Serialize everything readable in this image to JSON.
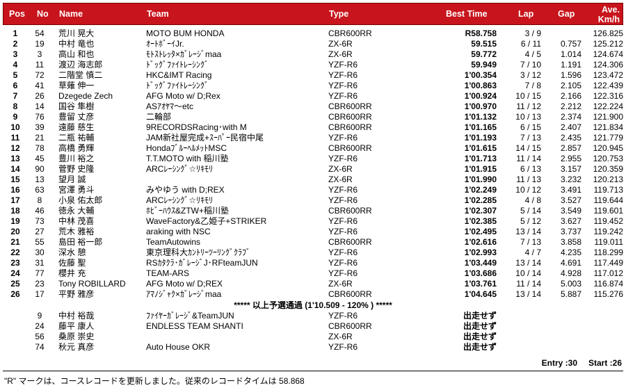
{
  "headers": {
    "pos": "Pos",
    "no": "No",
    "name": "Name",
    "team": "Team",
    "type": "Type",
    "best": "Best Time",
    "lap": "Lap",
    "gap": "Gap",
    "ave1": "Ave.",
    "ave2": "Km/h"
  },
  "rows": [
    {
      "pos": "1",
      "no": "54",
      "name": "荒川 晃大",
      "team": "MOTO BUM HONDA",
      "type": "CBR600RR",
      "best": "R58.758",
      "lap": "3 / 9",
      "gap": "",
      "ave": "126.825"
    },
    {
      "pos": "2",
      "no": "19",
      "name": "中村 竜也",
      "team": "ｵｰﾄﾎﾞｰｲJr.",
      "type": "ZX-6R",
      "best": "59.515",
      "lap": "6 / 11",
      "gap": "0.757",
      "ave": "125.212"
    },
    {
      "pos": "3",
      "no": "3",
      "name": "高山 和也",
      "team": "ﾓﾄｽﾄﾚｯﾀ×ｶﾞﾚｰｼﾞmaa",
      "type": "ZX-6R",
      "best": "59.772",
      "lap": "4 / 5",
      "gap": "1.014",
      "ave": "124.674"
    },
    {
      "pos": "4",
      "no": "11",
      "name": "渡辺 海志郎",
      "team": "ﾄﾞｯｸﾞﾌｧｲﾄﾚｰｼﾝｸﾞ",
      "type": "YZF-R6",
      "best": "59.949",
      "lap": "7 / 10",
      "gap": "1.191",
      "ave": "124.306"
    },
    {
      "pos": "5",
      "no": "72",
      "name": "二階堂 慎二",
      "team": "HKC&IMT Racing",
      "type": "YZF-R6",
      "best": "1'00.354",
      "lap": "3 / 12",
      "gap": "1.596",
      "ave": "123.472"
    },
    {
      "pos": "6",
      "no": "41",
      "name": "草薙 伸一",
      "team": "ﾄﾞｯｸﾞﾌｧｲﾄﾚｰｼﾝｸﾞ",
      "type": "YZF-R6",
      "best": "1'00.863",
      "lap": "7 / 8",
      "gap": "2.105",
      "ave": "122.439"
    },
    {
      "pos": "7",
      "no": "26",
      "name": "Dzegede Zech",
      "team": "AFG Moto w/ D;Rex",
      "type": "YZF-R6",
      "best": "1'00.924",
      "lap": "10 / 15",
      "gap": "2.166",
      "ave": "122.316"
    },
    {
      "pos": "8",
      "no": "14",
      "name": "国谷 隼樹",
      "team": "ASｱｵﾔﾏ～etc",
      "type": "CBR600RR",
      "best": "1'00.970",
      "lap": "11 / 12",
      "gap": "2.212",
      "ave": "122.224"
    },
    {
      "pos": "9",
      "no": "76",
      "name": "豊留 丈彦",
      "team": "二輪部",
      "type": "CBR600RR",
      "best": "1'01.132",
      "lap": "10 / 13",
      "gap": "2.374",
      "ave": "121.900"
    },
    {
      "pos": "10",
      "no": "39",
      "name": "遠藤 慈生",
      "team": "9RECORDSRacing･with M",
      "type": "CBR600RR",
      "best": "1'01.165",
      "lap": "6 / 15",
      "gap": "2.407",
      "ave": "121.834"
    },
    {
      "pos": "11",
      "no": "21",
      "name": "二瓶 祐輔",
      "team": "JAM新社屋完成+ｽｰﾊﾟｰ民宿中尾",
      "type": "YZF-R6",
      "best": "1'01.193",
      "lap": "7 / 13",
      "gap": "2.435",
      "ave": "121.779"
    },
    {
      "pos": "12",
      "no": "78",
      "name": "高橋 勇輝",
      "team": "HondaﾌﾞﾙｰﾍﾙﾒｯﾄMSC",
      "type": "CBR600RR",
      "best": "1'01.615",
      "lap": "14 / 15",
      "gap": "2.857",
      "ave": "120.945"
    },
    {
      "pos": "13",
      "no": "45",
      "name": "豊川 裕之",
      "team": "T.T.MOTO with 稲川塾",
      "type": "YZF-R6",
      "best": "1'01.713",
      "lap": "11 / 14",
      "gap": "2.955",
      "ave": "120.753"
    },
    {
      "pos": "14",
      "no": "90",
      "name": "菅野 史隆",
      "team": "ARCﾚｰｼﾝｸﾞ☆ﾘｷﾓﾘ",
      "type": "ZX-6R",
      "best": "1'01.915",
      "lap": "6 / 13",
      "gap": "3.157",
      "ave": "120.359"
    },
    {
      "pos": "15",
      "no": "13",
      "name": "望月 誠",
      "team": "",
      "type": "ZX-6R",
      "best": "1'01.990",
      "lap": "11 / 13",
      "gap": "3.232",
      "ave": "120.213"
    },
    {
      "pos": "16",
      "no": "63",
      "name": "宮澤 勇斗",
      "team": "みやゆう with D;REX",
      "type": "YZF-R6",
      "best": "1'02.249",
      "lap": "10 / 12",
      "gap": "3.491",
      "ave": "119.713"
    },
    {
      "pos": "17",
      "no": "8",
      "name": "小泉 佑太郎",
      "team": "ARCﾚｰｼﾝｸﾞ☆ﾘｷﾓﾘ",
      "type": "YZF-R6",
      "best": "1'02.285",
      "lap": "4 / 8",
      "gap": "3.527",
      "ave": "119.644"
    },
    {
      "pos": "18",
      "no": "46",
      "name": "徳永 大輔",
      "team": "ﾎﾋﾞｰﾊｳｽ&ZTW+稲川塾",
      "type": "CBR600RR",
      "best": "1'02.307",
      "lap": "5 / 14",
      "gap": "3.549",
      "ave": "119.601"
    },
    {
      "pos": "19",
      "no": "73",
      "name": "中林 茂喜",
      "team": "WaveFactory&乙姫子+STRIKER",
      "type": "YZF-R6",
      "best": "1'02.385",
      "lap": "5 / 12",
      "gap": "3.627",
      "ave": "119.452"
    },
    {
      "pos": "20",
      "no": "27",
      "name": "荒木 雅裕",
      "team": "araking with NSC",
      "type": "YZF-R6",
      "best": "1'02.495",
      "lap": "13 / 14",
      "gap": "3.737",
      "ave": "119.242"
    },
    {
      "pos": "21",
      "no": "55",
      "name": "島田 裕一郎",
      "team": "TeamAutowins",
      "type": "CBR600RR",
      "best": "1'02.616",
      "lap": "7 / 13",
      "gap": "3.858",
      "ave": "119.011"
    },
    {
      "pos": "22",
      "no": "30",
      "name": "深水 憩",
      "team": "東京理科大ｶﾝﾄﾘｰﾂｰﾘﾝｸﾞｸﾗﾌﾞ",
      "type": "YZF-R6",
      "best": "1'02.993",
      "lap": "4 / 7",
      "gap": "4.235",
      "ave": "118.299"
    },
    {
      "pos": "23",
      "no": "31",
      "name": "佐藤 聖",
      "team": "RSｶﾀｸﾗ･ｶﾞﾚｰｼﾞJ･RFteamJUN",
      "type": "YZF-R6",
      "best": "1'03.449",
      "lap": "13 / 14",
      "gap": "4.691",
      "ave": "117.449"
    },
    {
      "pos": "24",
      "no": "77",
      "name": "櫻井 充",
      "team": "TEAM-ARS",
      "type": "YZF-R6",
      "best": "1'03.686",
      "lap": "10 / 14",
      "gap": "4.928",
      "ave": "117.012"
    },
    {
      "pos": "25",
      "no": "23",
      "name": "Tony ROBILLARD",
      "team": "AFG Moto w/ D;REX",
      "type": "ZX-6R",
      "best": "1'03.761",
      "lap": "11 / 14",
      "gap": "5.003",
      "ave": "116.874"
    },
    {
      "pos": "26",
      "no": "17",
      "name": "平野 雅彦",
      "team": "ｱﾏﾉｼﾞｬｸ×ｶﾞﾚｰｼﾞmaa",
      "type": "CBR600RR",
      "best": "1'04.645",
      "lap": "13 / 14",
      "gap": "5.887",
      "ave": "115.276"
    }
  ],
  "qualify_note": "***** 以上予選通過 (1'10.509 - 120% ) *****",
  "dns_rows": [
    {
      "no": "9",
      "name": "中村 裕哉",
      "team": "ﾌｧｲﾔｰｶﾞﾚｰｼﾞ&TeamJUN",
      "type": "YZF-R6",
      "best": "出走せず"
    },
    {
      "no": "24",
      "name": "藤平 康人",
      "team": "ENDLESS TEAM SHANTI",
      "type": "CBR600RR",
      "best": "出走せず"
    },
    {
      "no": "56",
      "name": "桑原 崇史",
      "team": "",
      "type": "ZX-6R",
      "best": "出走せず"
    },
    {
      "no": "74",
      "name": "秋元 真彦",
      "team": "Auto House OKR",
      "type": "YZF-R6",
      "best": "出走せず"
    }
  ],
  "summary": {
    "entry": "Entry :30",
    "start": "Start :26"
  },
  "footnote": "\"R\" マークは、コースレコードを更新しました。従来のレコードタイムは 58.868",
  "colors": {
    "header_bg": "#c8141c",
    "header_text": "#ffffff"
  }
}
